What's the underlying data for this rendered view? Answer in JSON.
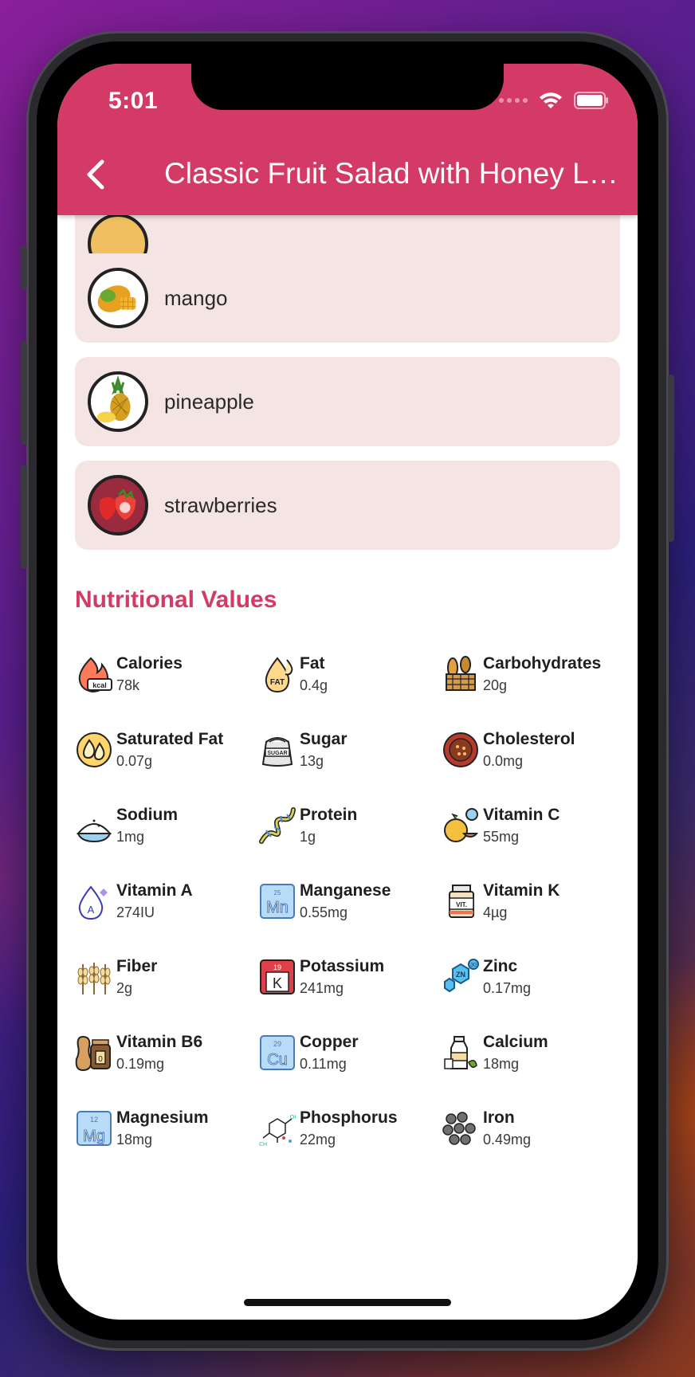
{
  "status_bar": {
    "time": "5:01"
  },
  "header": {
    "title": "Classic Fruit Salad with Honey Lime Dressing",
    "back_icon": "chevron-left-icon"
  },
  "ingredients": [
    {
      "name": "mango",
      "icon": "mango-icon"
    },
    {
      "name": "pineapple",
      "icon": "pineapple-icon"
    },
    {
      "name": "strawberries",
      "icon": "strawberries-icon"
    }
  ],
  "nutrition": {
    "title": "Nutritional Values",
    "items": [
      {
        "name": "Calories",
        "value": "78k",
        "icon": "calories-icon"
      },
      {
        "name": "Fat",
        "value": "0.4g",
        "icon": "fat-icon"
      },
      {
        "name": "Carbohydrates",
        "value": "20g",
        "icon": "carbohydrates-icon"
      },
      {
        "name": "Saturated Fat",
        "value": "0.07g",
        "icon": "saturated-fat-icon"
      },
      {
        "name": "Sugar",
        "value": "13g",
        "icon": "sugar-icon"
      },
      {
        "name": "Cholesterol",
        "value": "0.0mg",
        "icon": "cholesterol-icon"
      },
      {
        "name": "Sodium",
        "value": "1mg",
        "icon": "sodium-icon"
      },
      {
        "name": "Protein",
        "value": "1g",
        "icon": "protein-icon"
      },
      {
        "name": "Vitamin C",
        "value": "55mg",
        "icon": "vitamin-c-icon"
      },
      {
        "name": "Vitamin A",
        "value": "274IU",
        "icon": "vitamin-a-icon"
      },
      {
        "name": "Manganese",
        "value": "0.55mg",
        "icon": "manganese-icon"
      },
      {
        "name": "Vitamin K",
        "value": "4µg",
        "icon": "vitamin-k-icon"
      },
      {
        "name": "Fiber",
        "value": "2g",
        "icon": "fiber-icon"
      },
      {
        "name": "Potassium",
        "value": "241mg",
        "icon": "potassium-icon"
      },
      {
        "name": "Zinc",
        "value": "0.17mg",
        "icon": "zinc-icon"
      },
      {
        "name": "Vitamin B6",
        "value": "0.19mg",
        "icon": "vitamin-b6-icon"
      },
      {
        "name": "Copper",
        "value": "0.11mg",
        "icon": "copper-icon"
      },
      {
        "name": "Calcium",
        "value": "18mg",
        "icon": "calcium-icon"
      },
      {
        "name": "Magnesium",
        "value": "18mg",
        "icon": "magnesium-icon"
      },
      {
        "name": "Phosphorus",
        "value": "22mg",
        "icon": "phosphorus-icon"
      },
      {
        "name": "Iron",
        "value": "0.49mg",
        "icon": "iron-icon"
      }
    ]
  },
  "icon_labels": {
    "kcal": "kcal",
    "fat": "FAT",
    "sugar": "SUGAR",
    "vit_a": "A",
    "mn_num": "25",
    "mn": "Mn",
    "vit": "VIT.",
    "k_num": "19",
    "k": "K",
    "zn": "ZN",
    "zn_num": "30",
    "b6": "0",
    "cu_num": "29",
    "cu": "Cu",
    "mg_num": "12",
    "mg": "Mg",
    "oh": "OH",
    "ch": "CH"
  },
  "colors": {
    "brand": "#d43a66",
    "card": "#f5e4e4"
  }
}
